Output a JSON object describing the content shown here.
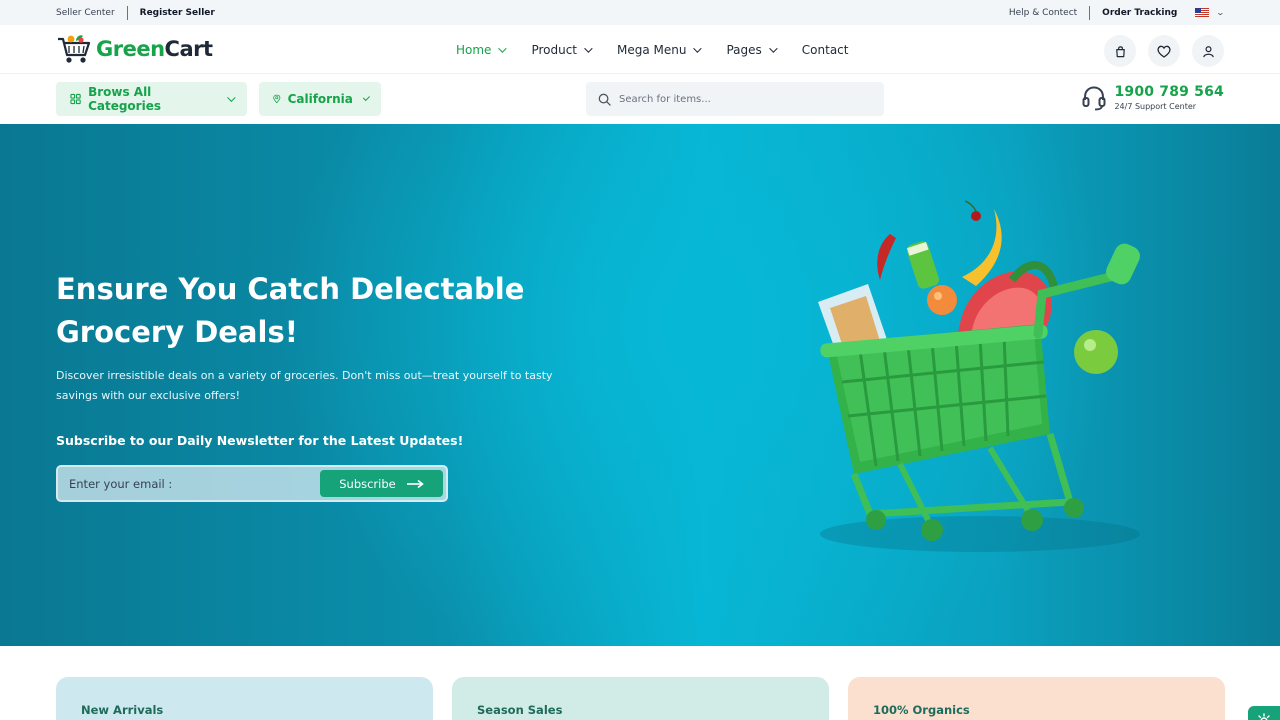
{
  "topbar": {
    "seller_center": "Seller Center",
    "register_seller": "Register Seller",
    "help_contact": "Help & Contect",
    "order_tracking": "Order Tracking"
  },
  "brand": {
    "name_part1": "Green",
    "name_part2": "Cart"
  },
  "nav": {
    "items": [
      {
        "label": "Home",
        "active": true,
        "dropdown": true
      },
      {
        "label": "Product",
        "active": false,
        "dropdown": true
      },
      {
        "label": "Mega Menu",
        "active": false,
        "dropdown": true
      },
      {
        "label": "Pages",
        "active": false,
        "dropdown": true
      },
      {
        "label": "Contact",
        "active": false,
        "dropdown": false
      }
    ],
    "icons": [
      "shopping-bag-icon",
      "heart-icon",
      "user-icon"
    ]
  },
  "subbar": {
    "categories_label": "Brows All Categories",
    "location_label": "California",
    "search_placeholder": "Search for items...",
    "support_phone": "1900 789 564",
    "support_label": "24/7 Support Center"
  },
  "hero": {
    "title": "Ensure You Catch Delectable Grocery Deals!",
    "description": "Discover irresistible deals on a variety of groceries. Don't miss out—treat yourself to tasty savings with our exclusive offers!",
    "newsletter_heading": "Subscribe to our Daily Newsletter for the Latest Updates!",
    "email_placeholder": "Enter your email :",
    "subscribe_label": "Subscribe"
  },
  "promo_cards": [
    {
      "label": "New Arrivals"
    },
    {
      "label": "Season Sales"
    },
    {
      "label": "100% Organics"
    }
  ],
  "colors": {
    "brand_green": "#16a34a",
    "hero_teal": "#07b6d4",
    "button_green": "#16a37a"
  }
}
